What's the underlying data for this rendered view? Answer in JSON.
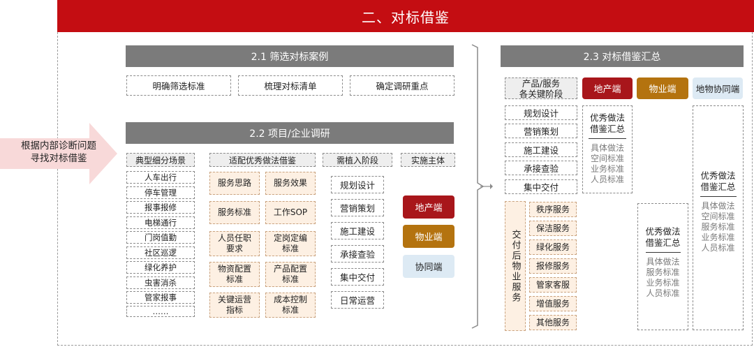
{
  "title": "二、对标借鉴",
  "left_arrow": {
    "line1": "根据内部诊断问题",
    "line2": "寻找对标借鉴"
  },
  "section_21": {
    "header": "2.1 筛选对标案例",
    "items": [
      "明确筛选标准",
      "梳理对标清单",
      "确定调研重点"
    ]
  },
  "section_22": {
    "header": "2.2 项目/企业调研",
    "col_headers": [
      "典型细分场景",
      "适配优秀做法借鉴",
      "需植入阶段",
      "实施主体"
    ],
    "scenes": [
      "人车出行",
      "停车管理",
      "报事报修",
      "电梯通行",
      "门岗值勤",
      "社区巡逻",
      "绿化养护",
      "虫害消杀",
      "管家报事",
      "……"
    ],
    "practices": [
      [
        "服务思路",
        "服务效果"
      ],
      [
        "服务标准",
        "工作SOP"
      ],
      [
        "人员任职\n要求",
        "定岗定编\n标准"
      ],
      [
        "物资配置\n标准",
        "产品配置\n标准"
      ],
      [
        "关键运营\n指标",
        "成本控制\n标准"
      ]
    ],
    "stages": [
      "规划设计",
      "营销策划",
      "施工建设",
      "承接查验",
      "集中交付",
      "日常运营"
    ],
    "subjects": [
      "地产端",
      "物业端",
      "协同端"
    ]
  },
  "section_23": {
    "header": "2.3 对标借鉴汇总",
    "phase_header": "产品/服务\n各关键阶段",
    "col_developer": "地产端",
    "col_property": "物业端",
    "col_synergy": "地物协同端",
    "phases": [
      "规划设计",
      "营销策划",
      "施工建设",
      "承接查验",
      "集中交付"
    ],
    "after_delivery_label": "交付后物业服务",
    "services": [
      "秩序服务",
      "保洁服务",
      "绿化服务",
      "报修服务",
      "管家客服",
      "增值服务",
      "其他服务"
    ],
    "summary_developer": {
      "title": "优秀做法\n借鉴汇总",
      "body": "具体做法\n空间标准\n业务标准\n人员标准"
    },
    "summary_property": {
      "title": "优秀做法\n借鉴汇总",
      "body": "具体做法\n服务标准\n业务标准\n人员标准"
    },
    "summary_synergy": {
      "title": "优秀做法\n借鉴汇总",
      "body": "具体做法\n空间标准\n服务标准\n业务标准\n人员标准"
    }
  },
  "colors": {
    "title_red": "#c40d12",
    "developer_red": "#a8161b",
    "property_brown": "#b4730f",
    "synergy_blue": "#ddeaf4",
    "header_gray": "#7b7b7b"
  }
}
